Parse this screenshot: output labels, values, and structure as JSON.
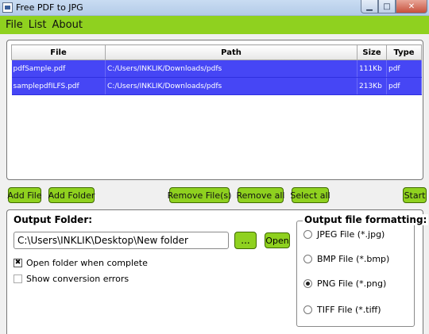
{
  "window": {
    "title": "Free PDF to JPG"
  },
  "menu": [
    "File",
    "List",
    "About"
  ],
  "table": {
    "headers": [
      "File",
      "Path",
      "Size",
      "Type"
    ],
    "rows": [
      [
        "pdfSample.pdf",
        "C:/Users/INKLIK/Downloads/pdfs",
        "111Kb",
        "pdf"
      ],
      [
        "samplepdfILFS.pdf",
        "C:/Users/INKLIK/Downloads/pdfs",
        "213Kb",
        "pdf"
      ]
    ]
  },
  "buttons": {
    "add_file": "Add File",
    "add_folder": "Add Folder",
    "remove_files": "Remove File(s)",
    "remove_all": "Remove all",
    "select_all": "Select all",
    "start": "Start"
  },
  "output": {
    "label": "Output Folder:",
    "folder_value": "C:\\Users\\INKLIK\\Desktop\\New folder",
    "browse_label": "...",
    "open_label": "Open",
    "open_when_complete": {
      "label": "Open folder when complete",
      "checked": true
    },
    "show_errors": {
      "label": "Show conversion errors",
      "checked": false
    }
  },
  "formatting": {
    "title": "Output file formatting:",
    "options": [
      {
        "label": "JPEG File (*.jpg)",
        "selected": false
      },
      {
        "label": "BMP File (*.bmp)",
        "selected": false
      },
      {
        "label": "PNG File (*.png)",
        "selected": true
      },
      {
        "label": "TIFF File (*.tiff)",
        "selected": false
      }
    ]
  },
  "colors": {
    "accent_green": "#8fd11f",
    "selection_blue": "#4646f5"
  }
}
